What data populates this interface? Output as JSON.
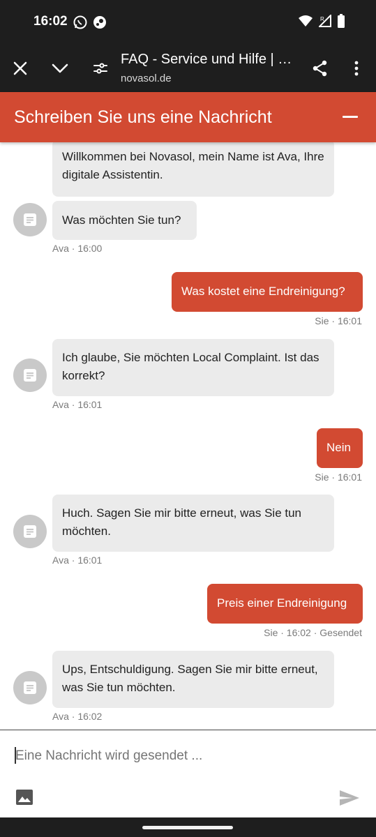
{
  "status_bar": {
    "time": "16:02",
    "left_icons": [
      "whatsapp-icon",
      "steam-icon"
    ],
    "right_icons": [
      "wifi-icon",
      "signal-icon",
      "battery-icon"
    ]
  },
  "browser": {
    "title": "FAQ - Service und Hilfe | …",
    "url": "novasol.de",
    "icons": [
      "close-icon",
      "chevron-down-icon",
      "site-settings-icon",
      "share-icon",
      "more-vert-icon"
    ]
  },
  "chat": {
    "header_title": "Schreiben Sie uns eine Nachricht",
    "accent_color": "#d24a32",
    "messages": [
      {
        "sender": "bot",
        "text": "Willkommen bei Novasol, mein Name ist Ava, Ihre digitale Assistentin."
      },
      {
        "sender": "bot",
        "text": "Was möchten Sie tun?",
        "meta": "Ava · 16:00"
      },
      {
        "sender": "user",
        "text": "Was kostet eine Endreinigung?",
        "meta": "Sie · 16:01"
      },
      {
        "sender": "bot",
        "text": "Ich glaube, Sie möchten Local Complaint. Ist das korrekt?",
        "meta": "Ava · 16:01"
      },
      {
        "sender": "user",
        "text": "Nein",
        "meta": "Sie · 16:01"
      },
      {
        "sender": "bot",
        "text": "Huch. Sagen Sie mir bitte erneut, was Sie tun möchten.",
        "meta": "Ava · 16:01"
      },
      {
        "sender": "user",
        "text": "Preis einer Endreinigung",
        "meta": "Sie · 16:02 · Gesendet"
      },
      {
        "sender": "bot",
        "text": "Ups, Entschuldigung. Sagen Sie mir bitte erneut, was Sie tun möchten.",
        "meta": "Ava · 16:02"
      }
    ],
    "input_placeholder": "Eine Nachricht wird gesendet ..."
  }
}
